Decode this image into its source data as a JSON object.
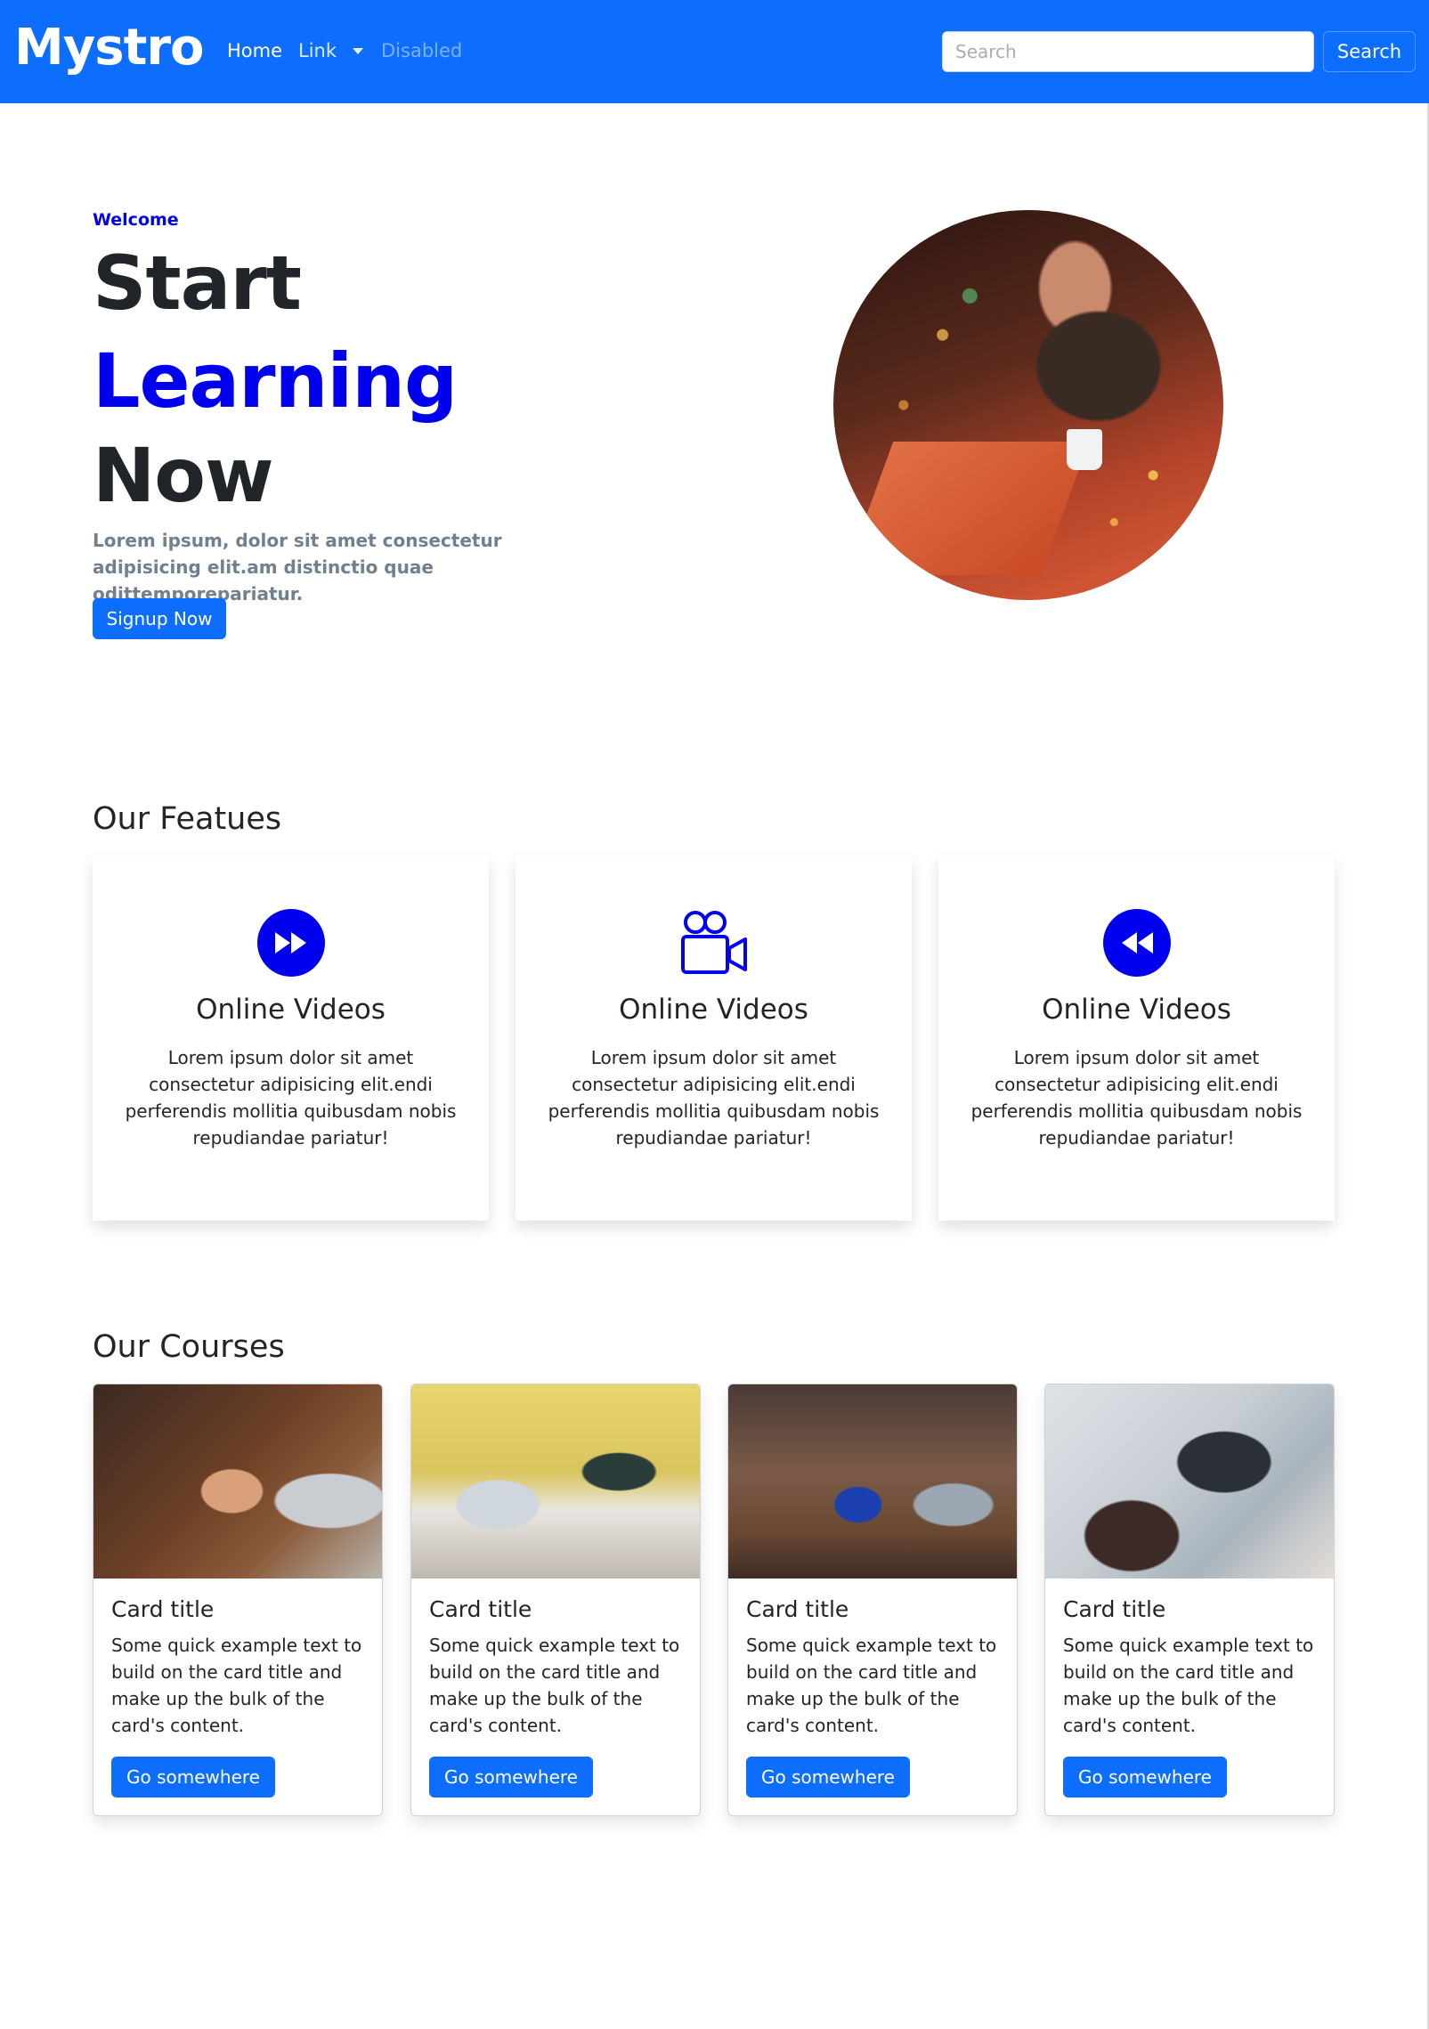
{
  "navbar": {
    "brand": "Mystro",
    "links": {
      "home": "Home",
      "link": "Link",
      "disabled": "Disabled"
    },
    "search": {
      "placeholder": "Search",
      "value": "",
      "button": "Search"
    }
  },
  "hero": {
    "eyebrow": "Welcome",
    "line1": "Start",
    "line2": "Learning",
    "line3": "Now",
    "lead": "Lorem ipsum, dolor sit amet consectetur adipisicing elit.am distinctio quae odittemporepariatur.",
    "button": "Signup Now"
  },
  "features": {
    "title": "Our Featues",
    "items": [
      {
        "icon": "fast-forward-circle-icon",
        "title": "Online Videos",
        "text": "Lorem ipsum dolor sit amet consectetur adipisicing elit.endi perferendis mollitia quibusdam nobis repudiandae pariatur!"
      },
      {
        "icon": "camera-reels-icon",
        "title": "Online Videos",
        "text": "Lorem ipsum dolor sit amet consectetur adipisicing elit.endi perferendis mollitia quibusdam nobis repudiandae pariatur!"
      },
      {
        "icon": "rewind-circle-icon",
        "title": "Online Videos",
        "text": "Lorem ipsum dolor sit amet consectetur adipisicing elit.endi perferendis mollitia quibusdam nobis repudiandae pariatur!"
      }
    ]
  },
  "courses": {
    "title": "Our Courses",
    "items": [
      {
        "title": "Card title",
        "text": "Some quick example text to build on the card title and make up the bulk of the card's content.",
        "button": "Go somewhere"
      },
      {
        "title": "Card title",
        "text": "Some quick example text to build on the card title and make up the bulk of the card's content.",
        "button": "Go somewhere"
      },
      {
        "title": "Card title",
        "text": "Some quick example text to build on the card title and make up the bulk of the card's content.",
        "button": "Go somewhere"
      },
      {
        "title": "Card title",
        "text": "Some quick example text to build on the card title and make up the bulk of the card's content.",
        "button": "Go somewhere"
      }
    ]
  },
  "colors": {
    "primary": "#0d6efd",
    "accent": "#0000ee",
    "muted": "#708090"
  }
}
